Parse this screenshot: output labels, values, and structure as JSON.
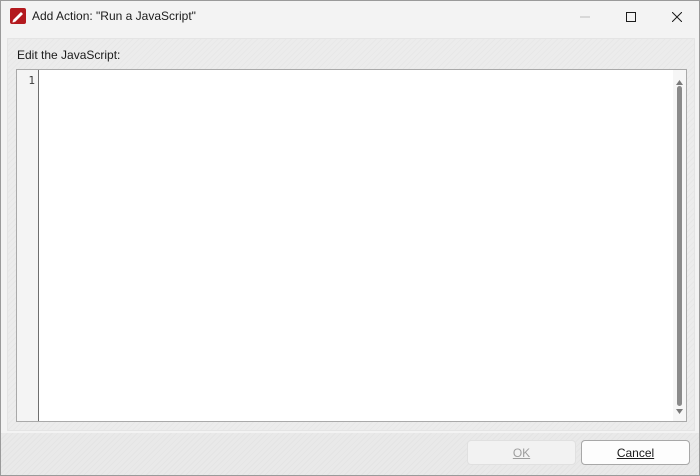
{
  "window": {
    "title": "Add Action: \"Run a JavaScript\"",
    "app_icon": "pdf-editor-icon",
    "controls": {
      "minimize_icon": "minimize-icon",
      "maximize_icon": "maximize-icon",
      "close_icon": "close-icon"
    }
  },
  "editor": {
    "label": "Edit the JavaScript:",
    "line_numbers": [
      "1"
    ],
    "code": ""
  },
  "buttons": {
    "ok": {
      "label": "OK",
      "enabled": false
    },
    "cancel": {
      "label": "Cancel",
      "enabled": true
    }
  },
  "colors": {
    "app_icon_red": "#b3191e",
    "window_bg": "#f3f3f3",
    "editor_bg": "#ffffff"
  }
}
